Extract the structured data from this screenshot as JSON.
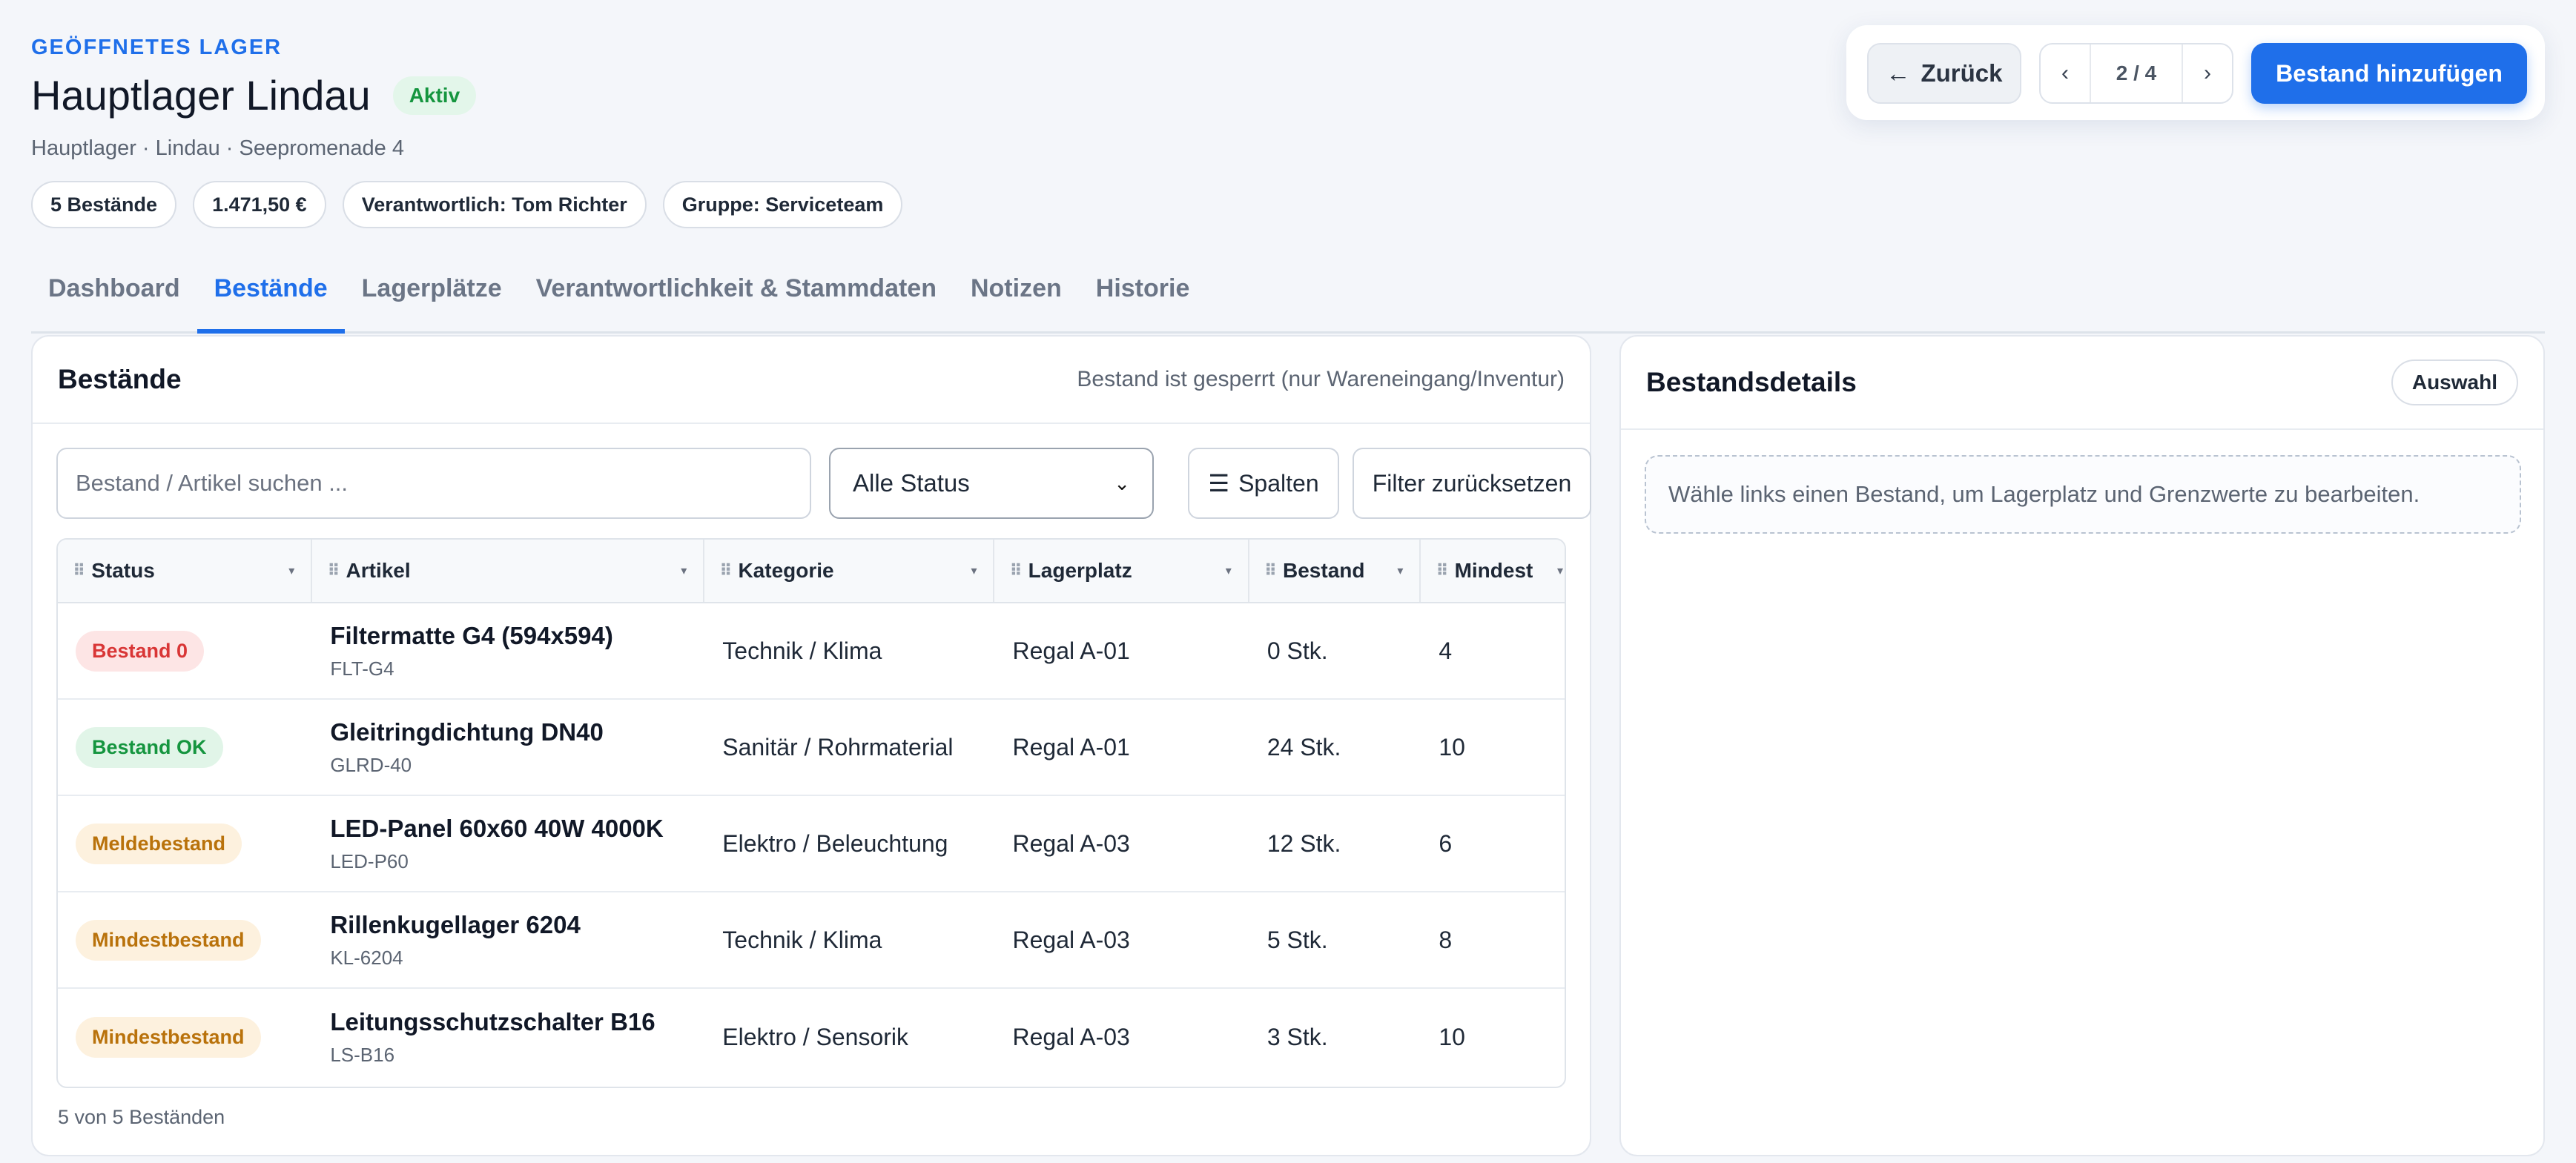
{
  "header": {
    "eyebrow": "GEÖFFNETES LAGER",
    "title": "Hauptlager Lindau",
    "status_badge": "Aktiv",
    "subtitle": "Hauptlager · Lindau · Seepromenade 4",
    "chips": [
      "5 Bestände",
      "1.471,50 €",
      "Verantwortlich: Tom Richter",
      "Gruppe: Serviceteam"
    ]
  },
  "toolbar": {
    "back_icon": "←",
    "back_label": "Zurück",
    "prev": "‹",
    "pager": "2 / 4",
    "next": "›",
    "add_label": "Bestand hinzufügen"
  },
  "tabs": [
    {
      "label": "Dashboard",
      "active": false
    },
    {
      "label": "Bestände",
      "active": true
    },
    {
      "label": "Lagerplätze",
      "active": false
    },
    {
      "label": "Verantwortlichkeit & Stammdaten",
      "active": false
    },
    {
      "label": "Notizen",
      "active": false
    },
    {
      "label": "Historie",
      "active": false
    }
  ],
  "stock_panel": {
    "title": "Bestände",
    "note": "Bestand ist gesperrt (nur Wareneingang/Inventur)",
    "search_placeholder": "Bestand / Artikel suchen ...",
    "status_filter": "Alle Status",
    "columns_icon": "☰",
    "columns_label": "Spalten",
    "reset_label": "Filter zurücksetzen",
    "columns": [
      "Status",
      "Artikel",
      "Kategorie",
      "Lagerplatz",
      "Bestand",
      "Mindest"
    ],
    "rows": [
      {
        "status": "Bestand 0",
        "tone": "red",
        "name": "Filtermatte G4 (594x594)",
        "code": "FLT-G4",
        "category": "Technik / Klima",
        "location": "Regal A-01",
        "stock": "0 Stk.",
        "min": "4"
      },
      {
        "status": "Bestand OK",
        "tone": "green",
        "name": "Gleitringdichtung DN40",
        "code": "GLRD-40",
        "category": "Sanitär / Rohrmaterial",
        "location": "Regal A-01",
        "stock": "24 Stk.",
        "min": "10"
      },
      {
        "status": "Meldebestand",
        "tone": "amber",
        "name": "LED-Panel 60x60 40W 4000K",
        "code": "LED-P60",
        "category": "Elektro / Beleuchtung",
        "location": "Regal A-03",
        "stock": "12 Stk.",
        "min": "6"
      },
      {
        "status": "Mindestbestand",
        "tone": "amber",
        "name": "Rillenkugellager 6204",
        "code": "KL-6204",
        "category": "Technik / Klima",
        "location": "Regal A-03",
        "stock": "5 Stk.",
        "min": "8"
      },
      {
        "status": "Mindestbestand",
        "tone": "amber",
        "name": "Leitungsschutzschalter B16",
        "code": "LS-B16",
        "category": "Elektro / Sensorik",
        "location": "Regal A-03",
        "stock": "3 Stk.",
        "min": "10"
      }
    ],
    "footer": "5 von 5 Beständen"
  },
  "details_panel": {
    "title": "Bestandsdetails",
    "select_label": "Auswahl",
    "empty_hint": "Wähle links einen Bestand, um Lagerplatz und Grenzwerte zu bearbeiten."
  }
}
